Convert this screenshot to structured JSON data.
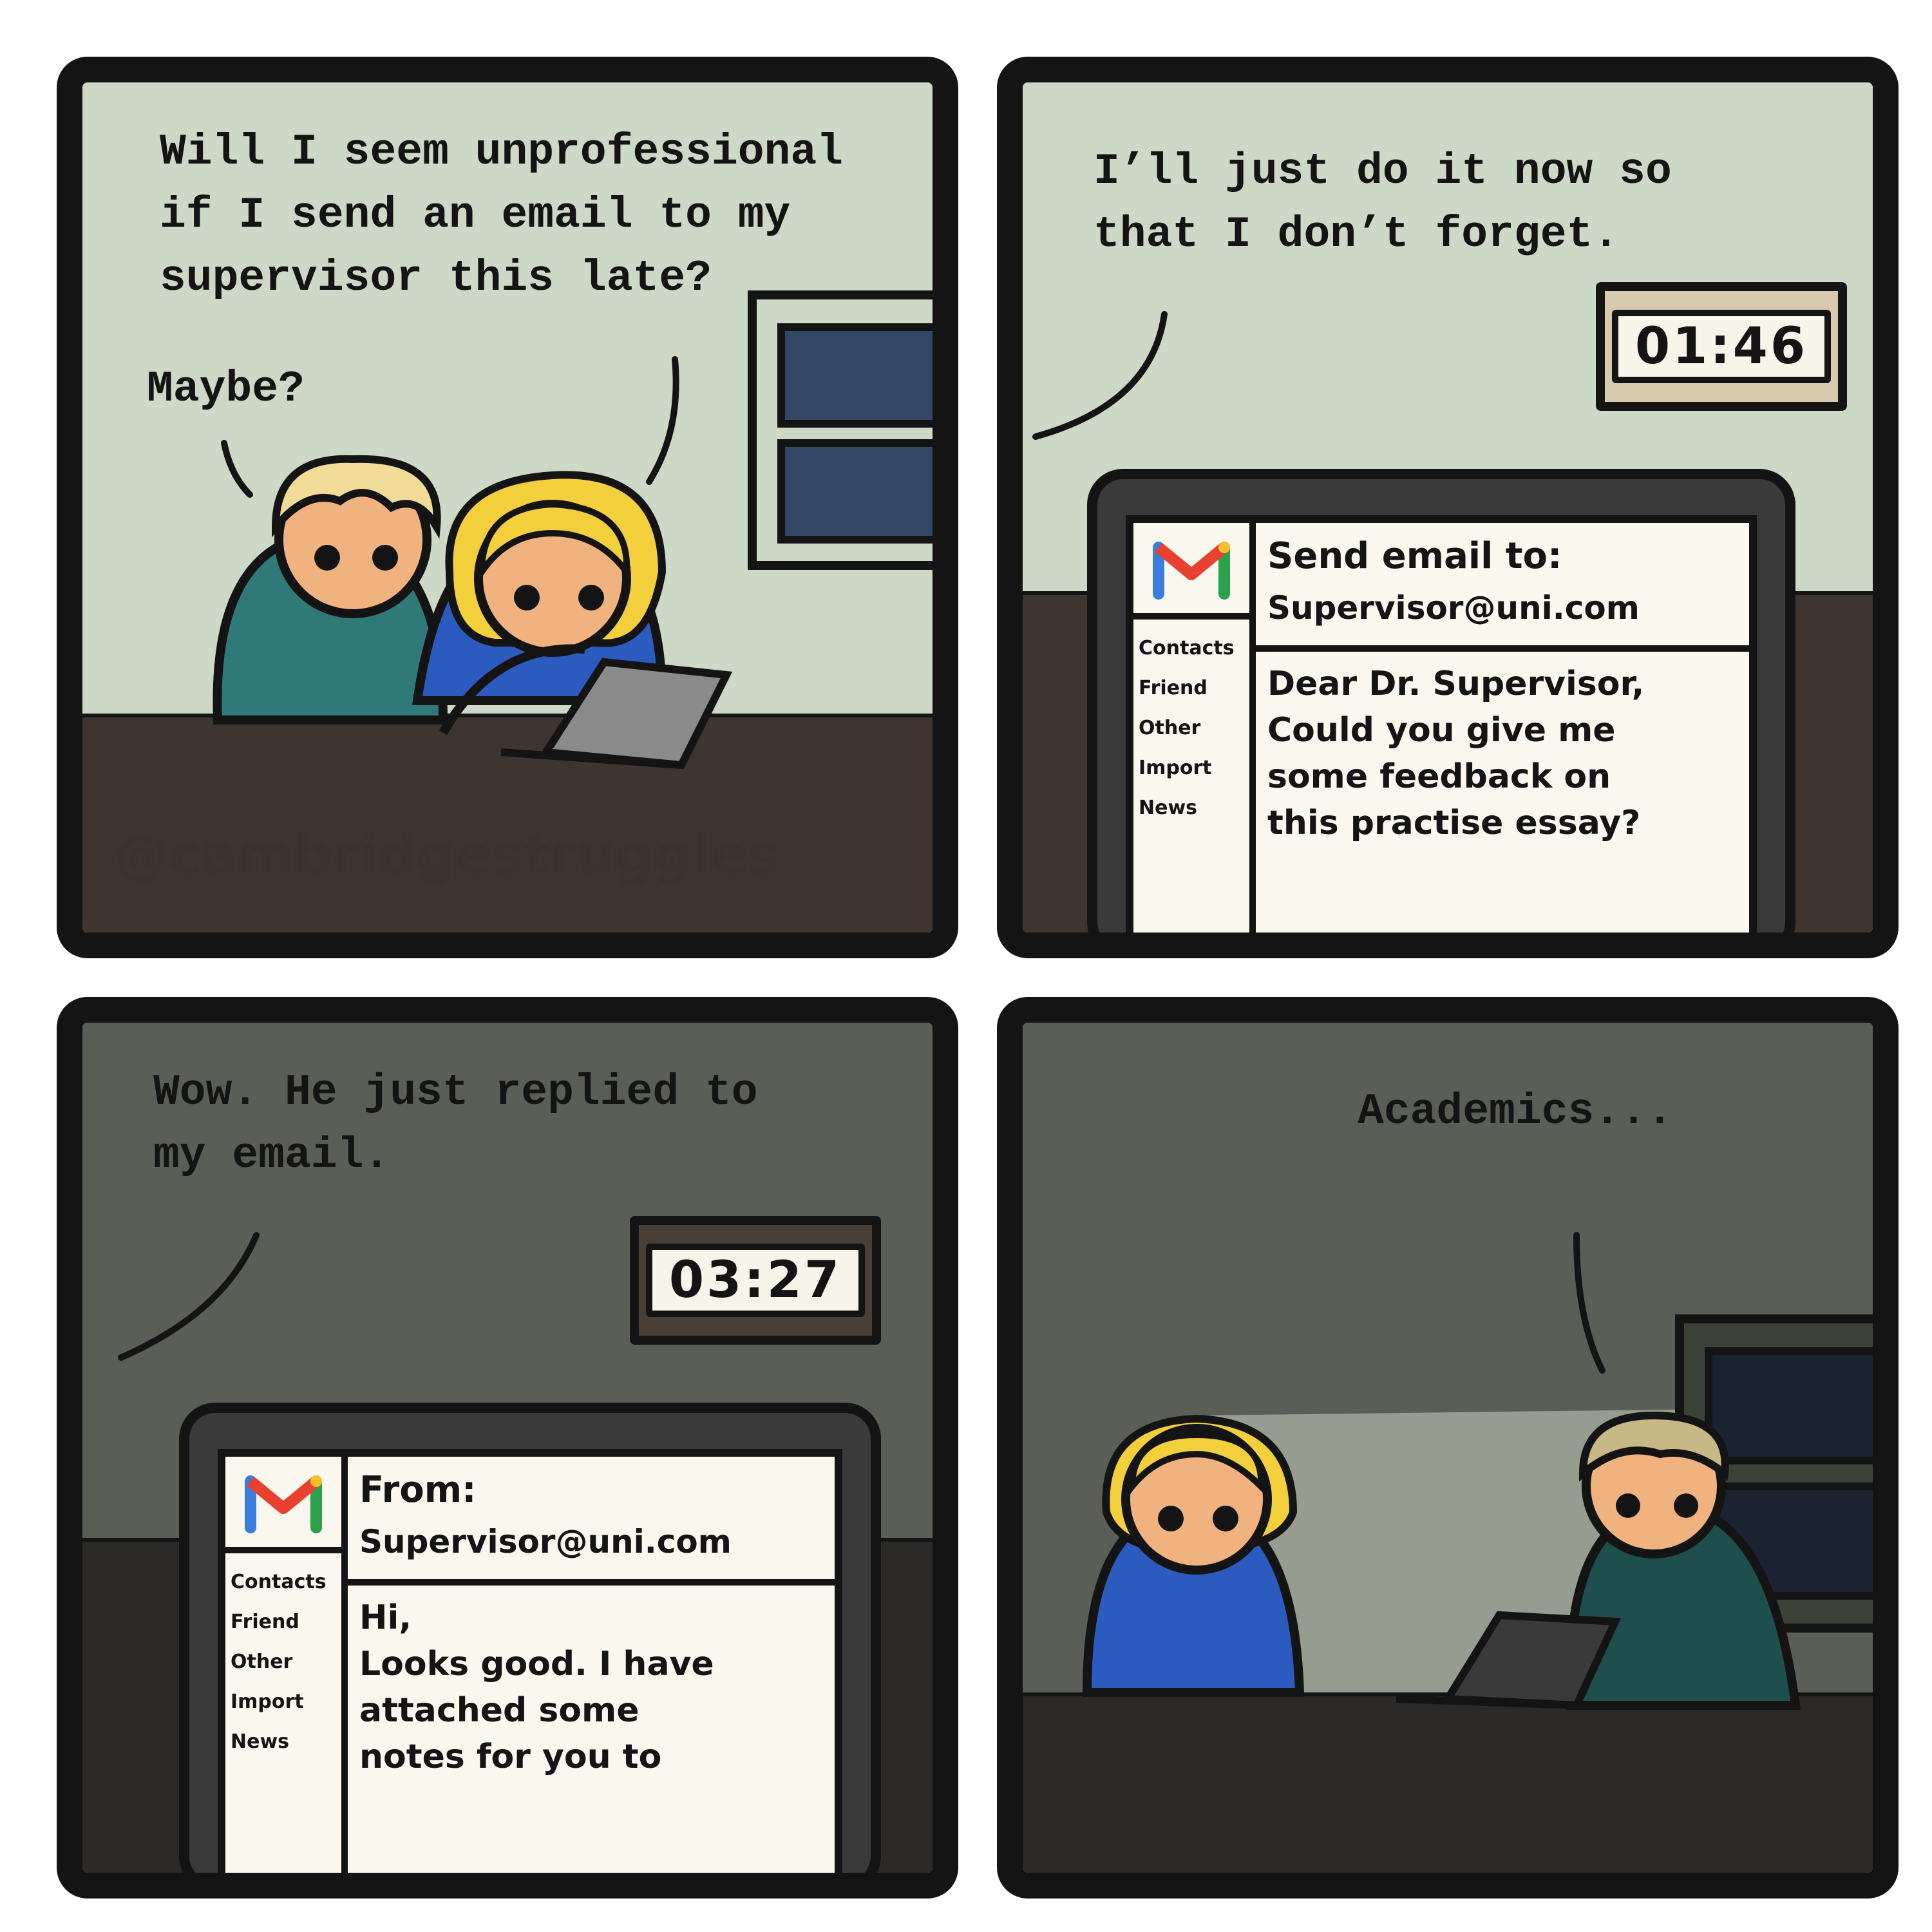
{
  "comic": {
    "panel1": {
      "speech_main": "Will I seem unprofessional\nif I send an email to my\nsupervisor this late?",
      "speech_reply": "Maybe?",
      "watermark": "@cambridgestruggles"
    },
    "panel2": {
      "speech": "I’ll just do it now so\nthat I don’t forget.",
      "clock": "01:46",
      "email": {
        "header_label": "Send email to:",
        "header_address": "Supervisor@uni.com",
        "body": "Dear Dr. Supervisor,\nCould you give me\nsome feedback on\nthis practise essay?",
        "sidebar": [
          "Contacts",
          "Friend",
          "Other",
          "Import",
          "News"
        ]
      }
    },
    "panel3": {
      "speech": "Wow. He just replied to\nmy email.",
      "clock": "03:27",
      "email": {
        "header_label": "From:",
        "header_address": "Supervisor@uni.com",
        "body": "Hi,\nLooks good. I have\nattached some\nnotes for you to",
        "sidebar": [
          "Contacts",
          "Friend",
          "Other",
          "Import",
          "News"
        ]
      }
    },
    "panel4": {
      "speech": "Academics..."
    }
  },
  "colors": {
    "outline": "#141414",
    "wall_light": "#cdd8c6",
    "wall_dark": "#5a5e56",
    "floor": "#3e3530",
    "girl_shirt": "#2b5bbf",
    "boy_shirt": "#2f7a78",
    "skin": "#f0b27f",
    "hair_girl": "#f2cf3b",
    "hair_boy": "#f0dc96",
    "window_glass": "#324766",
    "gmail_red": "#e8412f",
    "gmail_blue": "#3b7ddd",
    "gmail_green": "#2aa14a",
    "gmail_yellow": "#f8bf2d"
  }
}
